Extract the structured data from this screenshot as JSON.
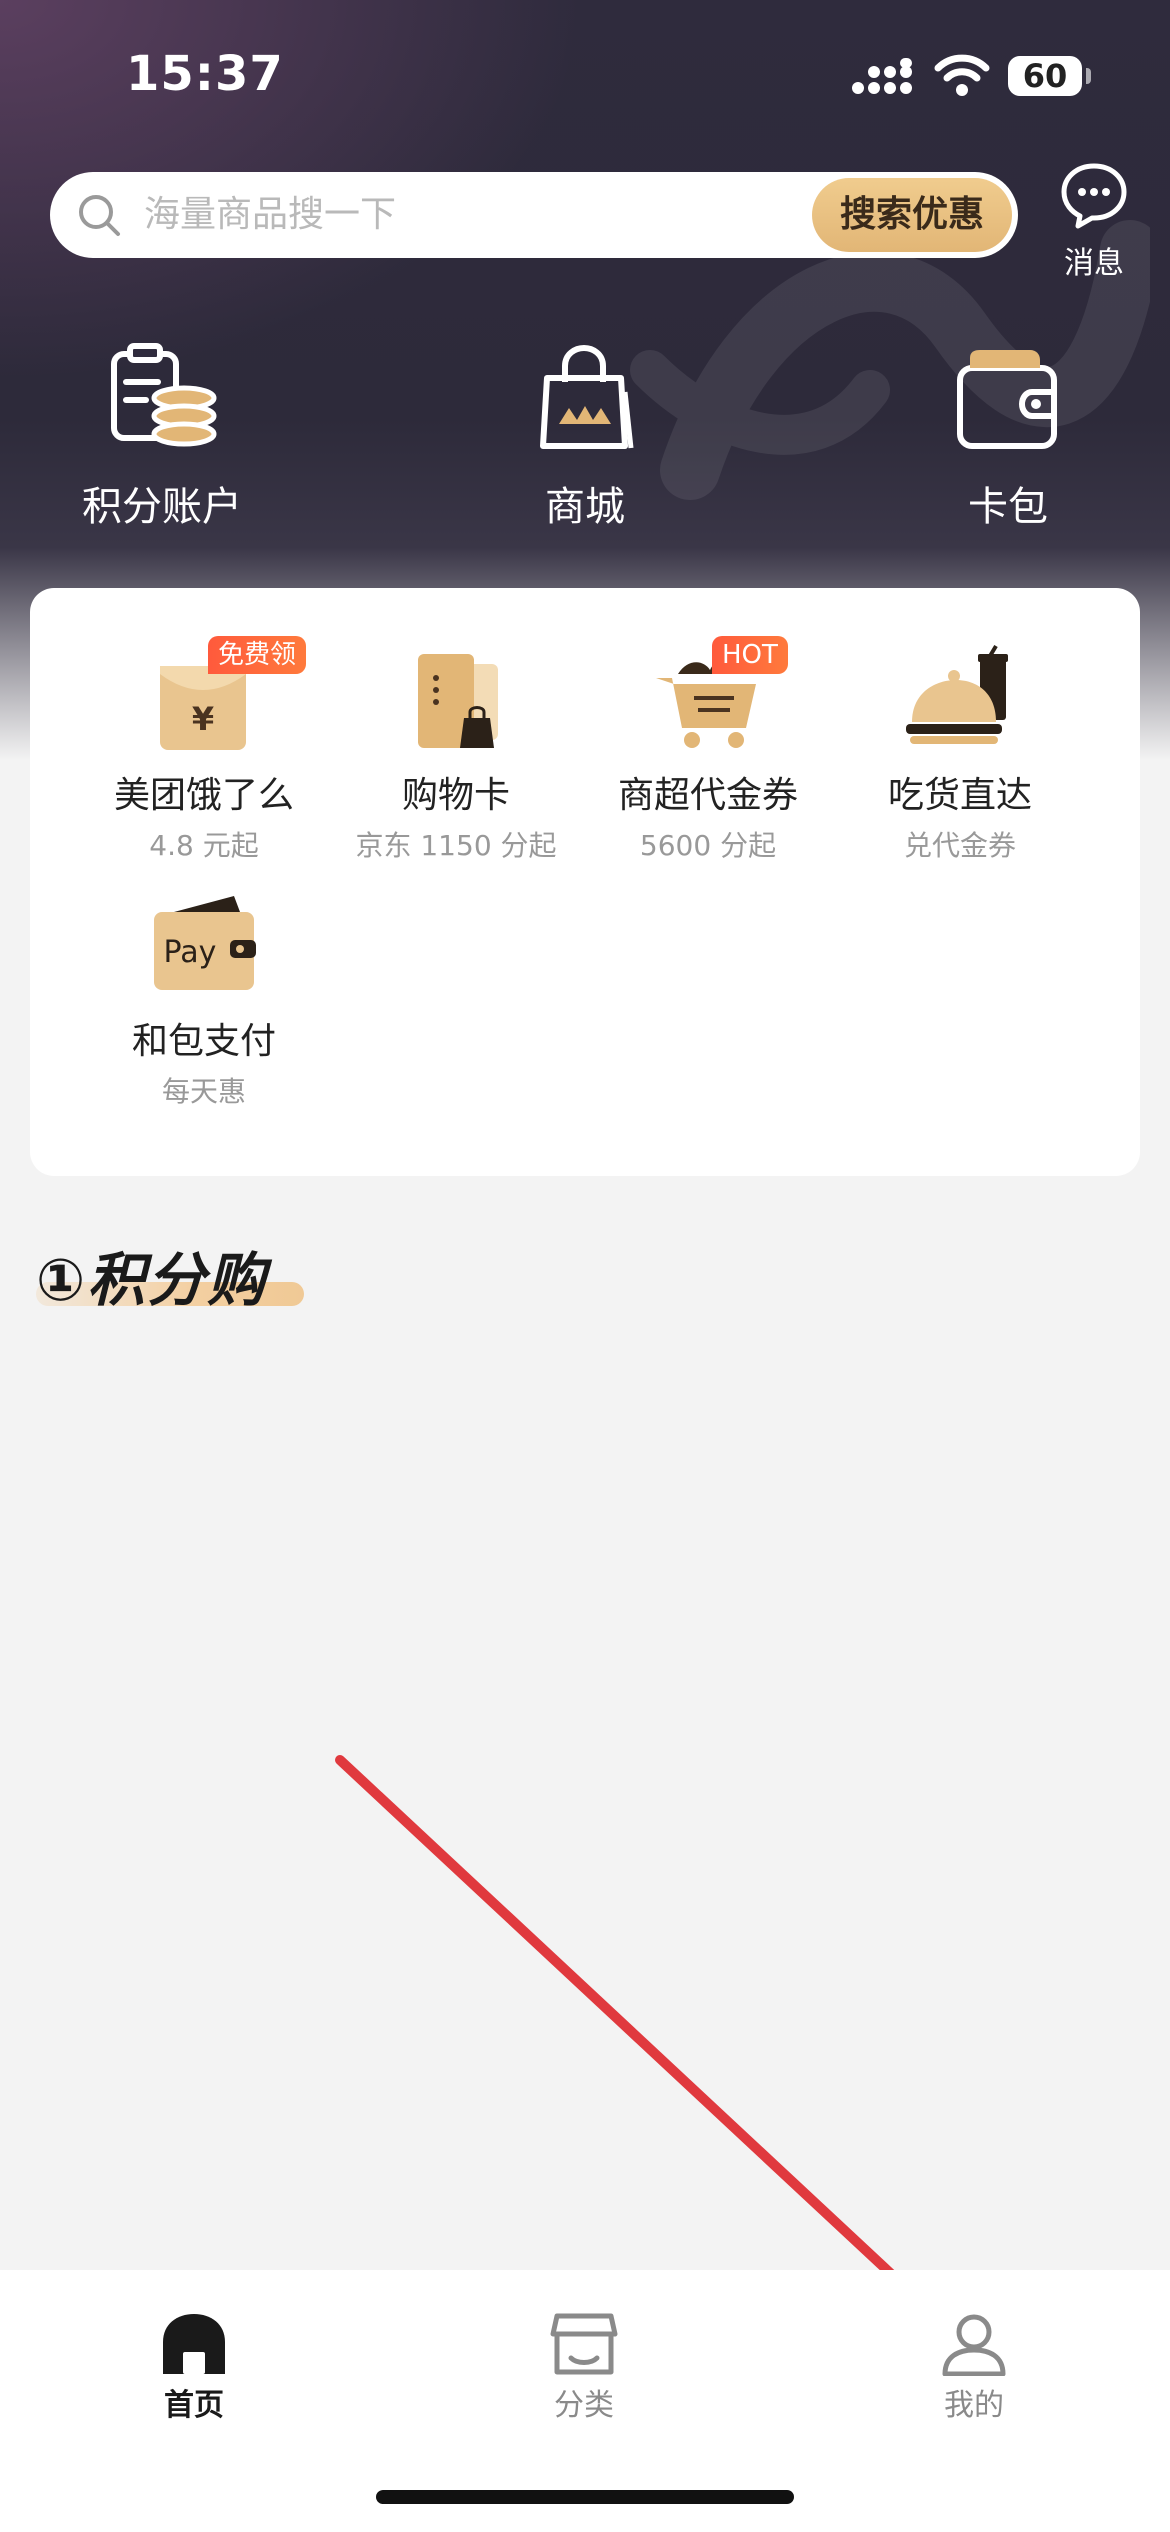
{
  "status_bar": {
    "time": "15:37",
    "battery": "60"
  },
  "search": {
    "placeholder": "海量商品搜一下",
    "button_label": "搜索优惠"
  },
  "message": {
    "label": "消息"
  },
  "top_nav": [
    {
      "label": "积分账户",
      "icon": "points-account-icon"
    },
    {
      "label": "商城",
      "icon": "shopping-bag-icon"
    },
    {
      "label": "卡包",
      "icon": "wallet-icon"
    }
  ],
  "services": [
    {
      "name": "美团饿了么",
      "sub": "4.8 元起",
      "tag": "免费领",
      "icon": "red-envelope-icon"
    },
    {
      "name": "购物卡",
      "sub": "京东 1150 分起",
      "tag": "",
      "icon": "shopping-card-icon"
    },
    {
      "name": "商超代金券",
      "sub": "5600 分起",
      "tag": "HOT",
      "icon": "shopping-cart-icon"
    },
    {
      "name": "吃货直达",
      "sub": "兑代金券",
      "tag": "",
      "icon": "food-cloche-icon"
    },
    {
      "name": "和包支付",
      "sub": "每天惠",
      "tag": "",
      "icon": "pay-wallet-icon",
      "icon_text": "Pay"
    }
  ],
  "section": {
    "title": "①积分购"
  },
  "tabbar": [
    {
      "label": "首页",
      "icon": "home-icon",
      "active": true
    },
    {
      "label": "分类",
      "icon": "store-icon",
      "active": false
    },
    {
      "label": "我的",
      "icon": "user-icon",
      "active": false
    }
  ],
  "colors": {
    "accent": "#e2b676",
    "header_dark": "#2f2b3d",
    "annotation_arrow": "#e0393e"
  }
}
